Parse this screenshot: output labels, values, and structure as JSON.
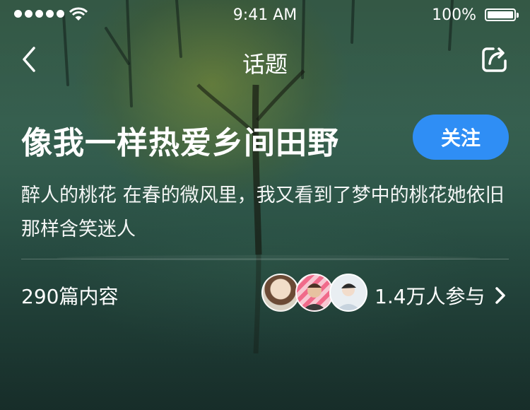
{
  "status_bar": {
    "time": "9:41 AM",
    "battery_percent": "100%",
    "battery_level": 1.0,
    "signal_icon": "signal-dots-icon",
    "wifi_icon": "wifi-icon"
  },
  "nav": {
    "title": "话题",
    "back_icon": "chevron-left-icon",
    "share_icon": "share-icon"
  },
  "topic": {
    "title": "像我一样热爱乡间田野",
    "follow_label": "关注",
    "description": "醉人的桃花 在春的微风里，我又看到了梦中的桃花她依旧那样含笑迷人",
    "content_count": "290篇内容",
    "participants": "1.4万人参与"
  },
  "colors": {
    "accent": "#2f8ef5",
    "background": "#3c6a58",
    "text": "#ffffff"
  }
}
